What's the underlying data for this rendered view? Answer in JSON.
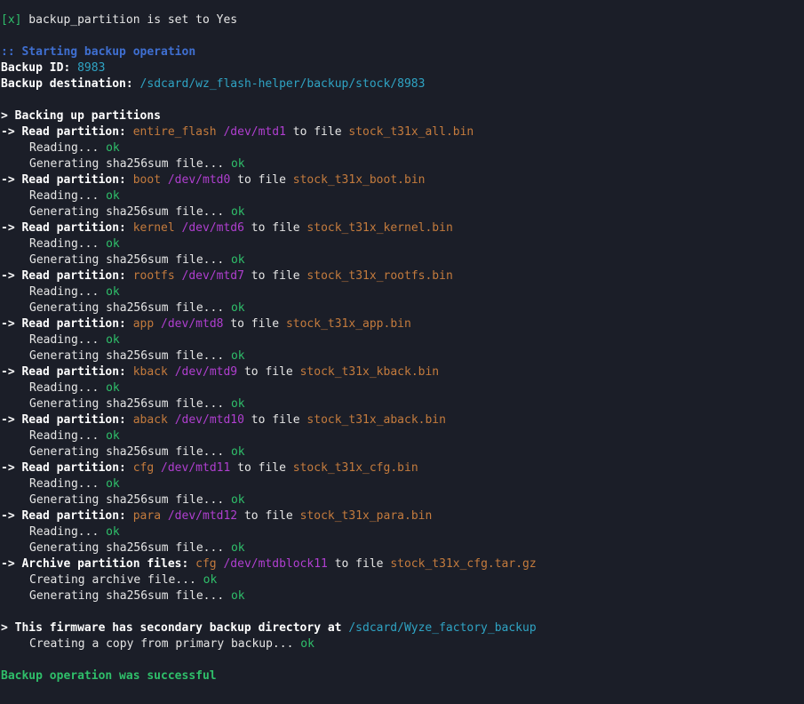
{
  "header": {
    "check_mark": "[x]",
    "check_text": " backup_partition is set to Yes"
  },
  "start": {
    "title": ":: Starting backup operation",
    "id_label": "Backup ID: ",
    "id_value": "8983",
    "dest_label": "Backup destination: ",
    "dest_value": "/sdcard/wz_flash-helper/backup/stock/8983"
  },
  "backing": {
    "title": "> Backing up partitions"
  },
  "labels": {
    "read": "-> Read partition: ",
    "to_file": " to file ",
    "reading": "Reading... ",
    "sha": "Generating sha256sum file... ",
    "ok": "ok",
    "archive": "-> Archive partition files: ",
    "creating_archive": "Creating archive file... "
  },
  "partitions": [
    {
      "name": "entire_flash",
      "dev": "/dev/mtd1",
      "file": "stock_t31x_all.bin"
    },
    {
      "name": "boot",
      "dev": "/dev/mtd0",
      "file": "stock_t31x_boot.bin"
    },
    {
      "name": "kernel",
      "dev": "/dev/mtd6",
      "file": "stock_t31x_kernel.bin"
    },
    {
      "name": "rootfs",
      "dev": "/dev/mtd7",
      "file": "stock_t31x_rootfs.bin"
    },
    {
      "name": "app",
      "dev": "/dev/mtd8",
      "file": "stock_t31x_app.bin"
    },
    {
      "name": "kback",
      "dev": "/dev/mtd9",
      "file": "stock_t31x_kback.bin"
    },
    {
      "name": "aback",
      "dev": "/dev/mtd10",
      "file": "stock_t31x_aback.bin"
    },
    {
      "name": "cfg",
      "dev": "/dev/mtd11",
      "file": "stock_t31x_cfg.bin"
    },
    {
      "name": "para",
      "dev": "/dev/mtd12",
      "file": "stock_t31x_para.bin"
    }
  ],
  "archive": {
    "name": "cfg",
    "dev": "/dev/mtdblock11",
    "file": "stock_t31x_cfg.tar.gz"
  },
  "secondary": {
    "label": "> This firmware has secondary backup directory at ",
    "path": "/sdcard/Wyze_factory_backup",
    "copy_text": "Creating a copy from primary backup... "
  },
  "result": {
    "message": "Backup operation was successful"
  },
  "colors": {
    "background": "#1b1e28",
    "green": "#2fbf6a",
    "blue": "#3f6fd1",
    "cyan": "#2fa4c4",
    "orange": "#c47b3d",
    "purple": "#b03fd0"
  }
}
